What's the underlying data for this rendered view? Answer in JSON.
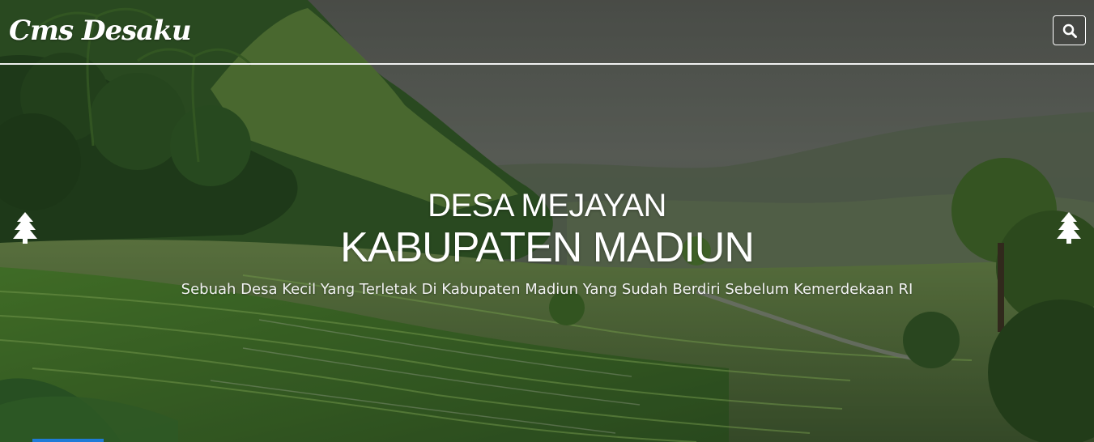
{
  "navbar": {
    "brand": "Cms Desaku",
    "search_icon": "search-icon"
  },
  "hero": {
    "title_line1": "DESA MEJAYAN",
    "title_line2": "KABUPATEN MADIUN",
    "subtitle": "Sebuah Desa Kecil Yang Terletak Di Kabupaten Madiun Yang Sudah Berdiri Sebelum Kemerdekaan RI",
    "prev_icon": "pine-tree-icon",
    "next_icon": "pine-tree-icon"
  },
  "colors": {
    "text": "#ffffff",
    "accent": "#1e7bd8"
  }
}
